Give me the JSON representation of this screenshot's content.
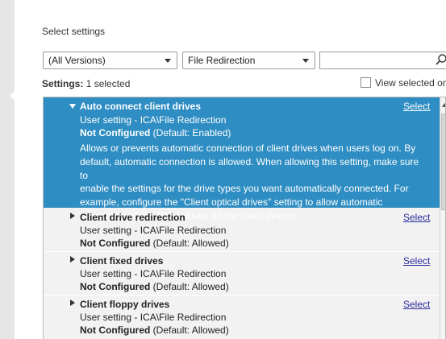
{
  "heading": "Select settings",
  "filters": {
    "version": "(All Versions)",
    "category": "File Redirection",
    "search_value": ""
  },
  "settings_summary": {
    "label": "Settings:",
    "count_text": "1 selected"
  },
  "view_selected_label": "View selected on",
  "colors": {
    "selected_bg": "#2e8dc2",
    "link": "#2a2a9c"
  },
  "items": [
    {
      "title": "Auto connect client drives",
      "path": "User setting - ICA\\File Redirection",
      "status": "Not Configured",
      "default": "(Default: Enabled)",
      "select_label": "Select",
      "expanded": true,
      "description": [
        "Allows or prevents automatic connection of client drives when users log on. By",
        "default, automatic connection is allowed. When allowing this setting, make sure to",
        "enable the settings for the drive types you want automatically connected. For",
        "example, configure the \"Client optical drives\" setting to allow automatic",
        "connection of CD-ROM drives on the client device."
      ]
    },
    {
      "title": "Client drive redirection",
      "path": "User setting - ICA\\File Redirection",
      "status": "Not Configured",
      "default": "(Default: Allowed)",
      "select_label": "Select",
      "expanded": false
    },
    {
      "title": "Client fixed drives",
      "path": "User setting - ICA\\File Redirection",
      "status": "Not Configured",
      "default": "(Default: Allowed)",
      "select_label": "Select",
      "expanded": false
    },
    {
      "title": "Client floppy drives",
      "path": "User setting - ICA\\File Redirection",
      "status": "Not Configured",
      "default": "(Default: Allowed)",
      "select_label": "Select",
      "expanded": false
    }
  ]
}
